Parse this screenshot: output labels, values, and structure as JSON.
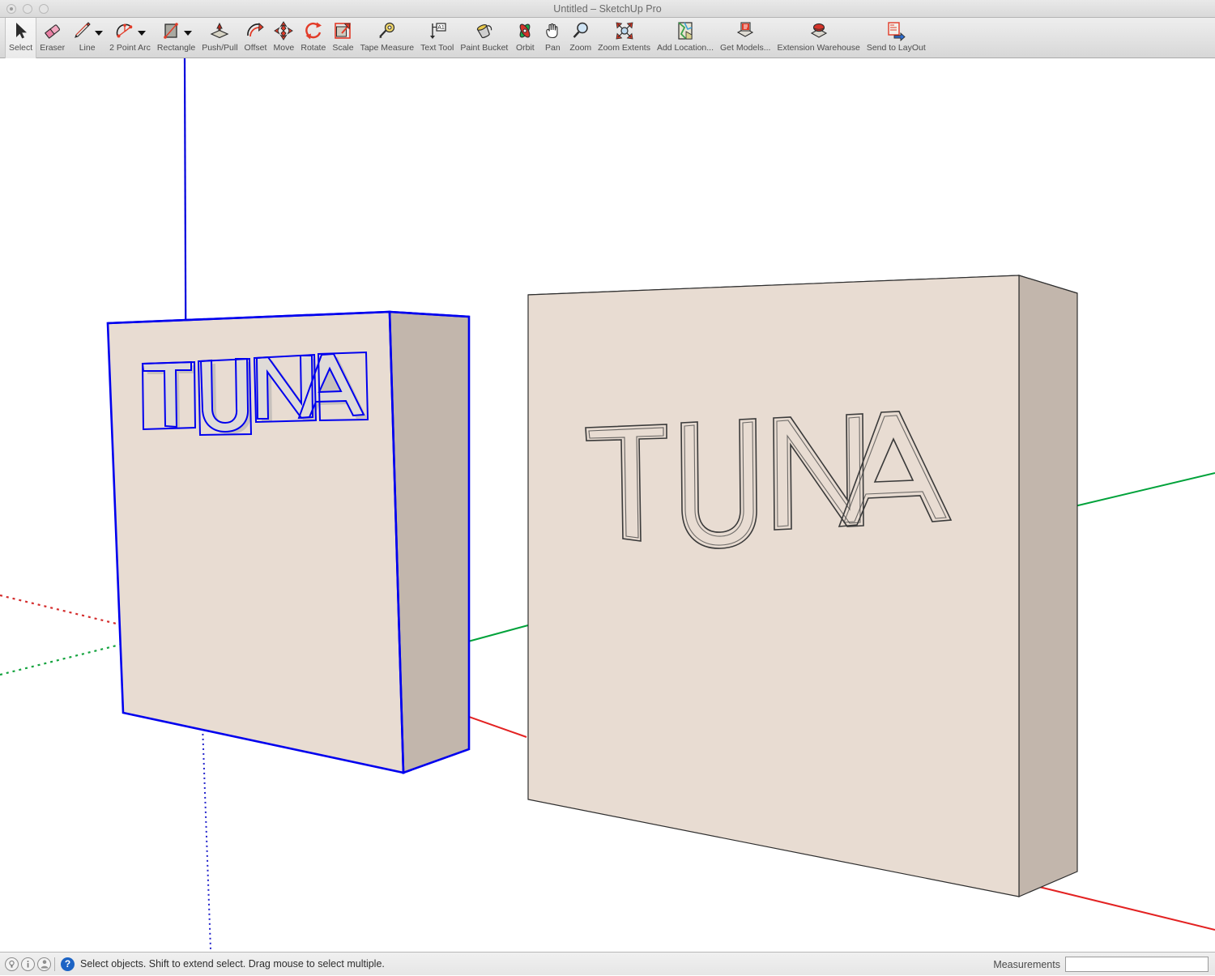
{
  "window": {
    "title": "Untitled – SketchUp Pro",
    "buttons": [
      "close",
      "minimize",
      "zoom"
    ]
  },
  "toolbar": {
    "tools": [
      {
        "label": "Select",
        "icon": "arrow-cursor-icon",
        "dropdown": false,
        "selected": true
      },
      {
        "label": "Eraser",
        "icon": "eraser-icon",
        "dropdown": false,
        "selected": false
      },
      {
        "label": "Line",
        "icon": "pencil-line-icon",
        "dropdown": true,
        "selected": false
      },
      {
        "label": "2 Point Arc",
        "icon": "two-point-arc-icon",
        "dropdown": true,
        "selected": false
      },
      {
        "label": "Rectangle",
        "icon": "rectangle-icon",
        "dropdown": true,
        "selected": false
      },
      {
        "label": "Push/Pull",
        "icon": "push-pull-icon",
        "dropdown": false,
        "selected": false
      },
      {
        "label": "Offset",
        "icon": "offset-icon",
        "dropdown": false,
        "selected": false
      },
      {
        "label": "Move",
        "icon": "move-arrows-icon",
        "dropdown": false,
        "selected": false
      },
      {
        "label": "Rotate",
        "icon": "rotate-icon",
        "dropdown": false,
        "selected": false
      },
      {
        "label": "Scale",
        "icon": "scale-icon",
        "dropdown": false,
        "selected": false
      },
      {
        "label": "Tape Measure",
        "icon": "tape-measure-icon",
        "dropdown": false,
        "selected": false
      },
      {
        "label": "Text Tool",
        "icon": "text-tool-icon",
        "dropdown": false,
        "selected": false
      },
      {
        "label": "Paint Bucket",
        "icon": "paint-bucket-icon",
        "dropdown": false,
        "selected": false
      },
      {
        "label": "Orbit",
        "icon": "orbit-icon",
        "dropdown": false,
        "selected": false
      },
      {
        "label": "Pan",
        "icon": "hand-pan-icon",
        "dropdown": false,
        "selected": false
      },
      {
        "label": "Zoom",
        "icon": "magnifier-zoom-icon",
        "dropdown": false,
        "selected": false
      },
      {
        "label": "Zoom Extents",
        "icon": "zoom-extents-icon",
        "dropdown": false,
        "selected": false
      },
      {
        "label": "Add Location...",
        "icon": "add-location-map-icon",
        "dropdown": false,
        "selected": false
      },
      {
        "label": "Get Models...",
        "icon": "get-models-icon",
        "dropdown": false,
        "selected": false
      },
      {
        "label": "Extension Warehouse",
        "icon": "extension-warehouse-icon",
        "dropdown": false,
        "selected": false
      },
      {
        "label": "Send to LayOut",
        "icon": "send-to-layout-icon",
        "dropdown": false,
        "selected": false
      }
    ]
  },
  "statusbar": {
    "icons": [
      "tips-bulb-icon",
      "info-icon",
      "account-person-icon"
    ],
    "help_badge": "?",
    "message": "Select objects. Shift to extend select. Drag mouse to select multiple.",
    "measurements_label": "Measurements",
    "measurements_value": "",
    "measurements_placeholder": ""
  },
  "canvas": {
    "model_text": "TUNA",
    "objects": [
      {
        "name": "selected-sign-board",
        "text": "TUNA",
        "selected": true,
        "letter_style": "extruded-raised"
      },
      {
        "name": "sign-board",
        "text": "TUNA",
        "selected": false,
        "letter_style": "engraved-outline"
      }
    ],
    "colors": {
      "face_front": "#e8dcd2",
      "face_side": "#c2b6ac",
      "face_top": "#ddd0c5",
      "edge": "#3a3a3a",
      "selection": "#0000ee",
      "letter_fill": "#dfdbd8",
      "letter_shadow": "#c9c4bf",
      "axis_red": "#e32222",
      "axis_green": "#00a23a",
      "axis_blue": "#0000dd",
      "background": "#ffffff"
    },
    "axes": [
      {
        "name": "axis-red-positive",
        "color": "#e32222",
        "style": "solid"
      },
      {
        "name": "axis-red-negative",
        "color": "#e32222",
        "style": "dotted"
      },
      {
        "name": "axis-green-positive",
        "color": "#00a23a",
        "style": "solid"
      },
      {
        "name": "axis-green-negative",
        "color": "#00a23a",
        "style": "dotted"
      },
      {
        "name": "axis-blue-positive",
        "color": "#0000dd",
        "style": "solid"
      },
      {
        "name": "axis-blue-negative",
        "color": "#0000dd",
        "style": "dotted"
      }
    ]
  }
}
